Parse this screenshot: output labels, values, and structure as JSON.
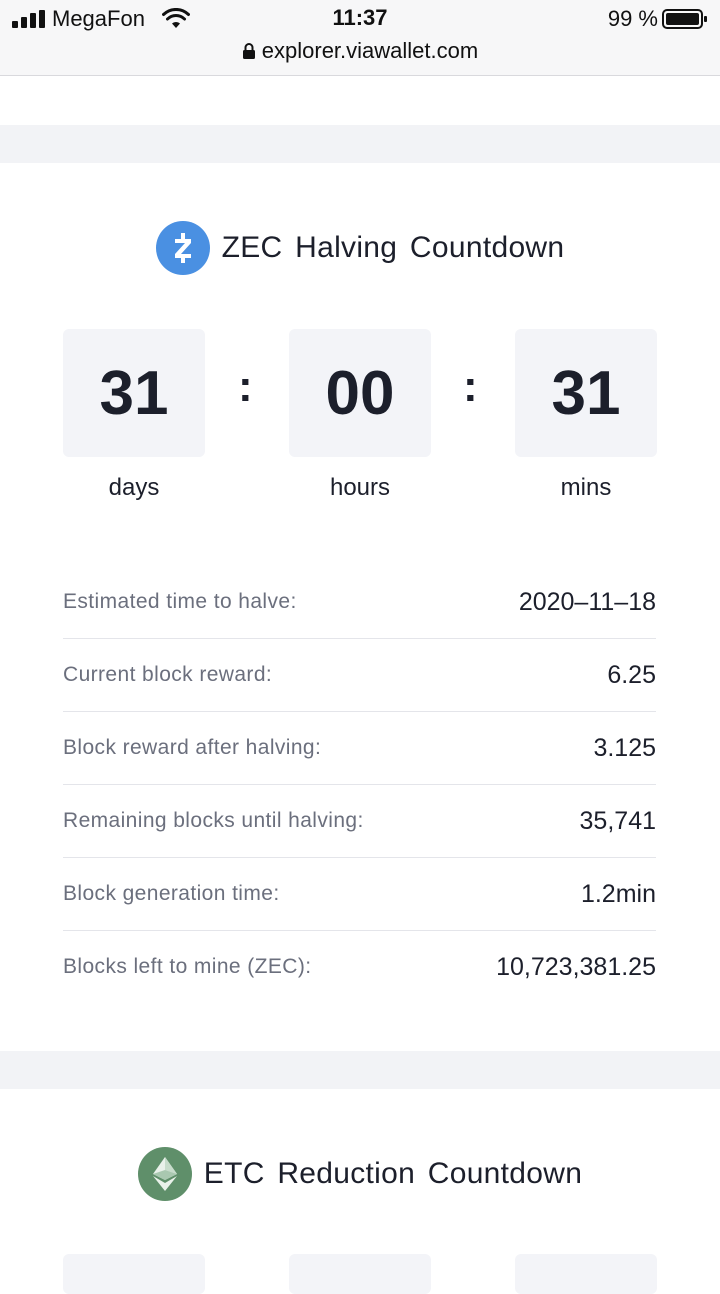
{
  "status_bar": {
    "carrier": "MegaFon",
    "time": "11:37",
    "battery": "99 %"
  },
  "browser": {
    "url": "explorer.viawallet.com"
  },
  "zec": {
    "title": "ZEC Halving Countdown",
    "icon_color": "#4a90e2",
    "countdown": [
      {
        "value": "31",
        "unit": "days"
      },
      {
        "value": "00",
        "unit": "hours"
      },
      {
        "value": "31",
        "unit": "mins"
      }
    ],
    "separator": ":",
    "info": [
      {
        "label": "Estimated time to halve:",
        "value": "2020–11–18"
      },
      {
        "label": "Current block reward:",
        "value": "6.25"
      },
      {
        "label": "Block reward after halving:",
        "value": "3.125"
      },
      {
        "label": "Remaining blocks until halving:",
        "value": "35,741"
      },
      {
        "label": "Block generation time:",
        "value": "1.2min"
      },
      {
        "label": "Blocks left to mine (ZEC):",
        "value": "10,723,381.25"
      }
    ]
  },
  "etc": {
    "title": "ETC Reduction Countdown",
    "icon_color": "#5f8f6a"
  }
}
